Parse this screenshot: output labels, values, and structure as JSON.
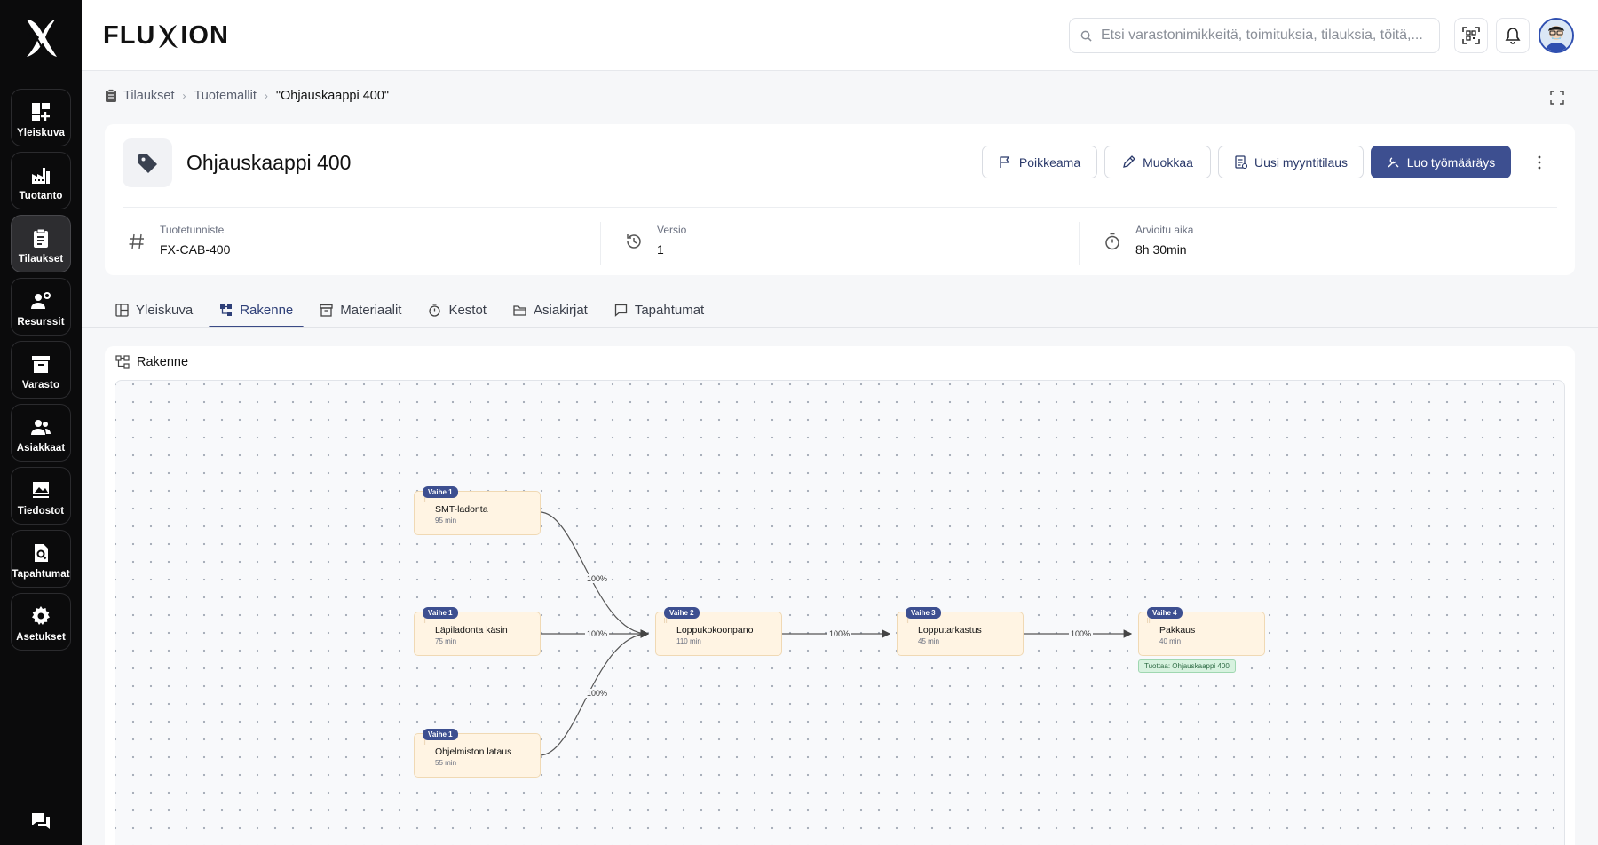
{
  "app": {
    "brand_left": "FLU",
    "brand_right": "ION"
  },
  "colors": {
    "sidebar_bg": "#0b0b0c",
    "accent": "#3d4f90",
    "node_bg": "#fff4e3",
    "output_tag_bg": "#d7f2df"
  },
  "sidebar": {
    "items": [
      {
        "label": "Yleiskuva",
        "icon": "dashboard-add-icon",
        "active": false
      },
      {
        "label": "Tuotanto",
        "icon": "factory-icon",
        "active": false
      },
      {
        "label": "Tilaukset",
        "icon": "clipboard-icon",
        "active": true
      },
      {
        "label": "Resurssit",
        "icon": "user-gear-icon",
        "active": false
      },
      {
        "label": "Varasto",
        "icon": "archive-icon",
        "active": false
      },
      {
        "label": "Asiakkaat",
        "icon": "people-icon",
        "active": false
      },
      {
        "label": "Tiedostot",
        "icon": "image-file-icon",
        "active": false
      },
      {
        "label": "Tapahtumat",
        "icon": "document-search-icon",
        "active": false
      },
      {
        "label": "Asetukset",
        "icon": "gear-icon",
        "active": false
      }
    ]
  },
  "header": {
    "search_placeholder": "Etsi varastonimikkeitä, toimituksia, tilauksia, töitä,..."
  },
  "breadcrumb": {
    "items": [
      "Tilaukset",
      "Tuotemallit"
    ],
    "current": "\"Ohjauskaappi 400\""
  },
  "product": {
    "title": "Ohjauskaappi 400",
    "actions": {
      "deviation": "Poikkeama",
      "edit": "Muokkaa",
      "new_sales_order": "Uusi myyntitilaus",
      "create_work_order": "Luo työmääräys"
    },
    "meta": [
      {
        "label": "Tuotetunniste",
        "value": "FX-CAB-400",
        "icon": "hash-icon"
      },
      {
        "label": "Versio",
        "value": "1",
        "icon": "history-icon"
      },
      {
        "label": "Arvioitu aika",
        "value": "8h 30min",
        "icon": "timer-icon"
      }
    ]
  },
  "tabs": [
    {
      "label": "Yleiskuva",
      "icon": "layout-icon",
      "active": false
    },
    {
      "label": "Rakenne",
      "icon": "tree-icon",
      "active": true
    },
    {
      "label": "Materiaalit",
      "icon": "box-icon",
      "active": false
    },
    {
      "label": "Kestot",
      "icon": "stopwatch-icon",
      "active": false
    },
    {
      "label": "Asiakirjat",
      "icon": "folder-icon",
      "active": false
    },
    {
      "label": "Tapahtumat",
      "icon": "message-icon",
      "active": false
    }
  ],
  "structure": {
    "title": "Rakenne",
    "nodes": [
      {
        "stage": "Vaihe 1",
        "name": "SMT-ladonta",
        "duration": "95 min"
      },
      {
        "stage": "Vaihe 1",
        "name": "Läpiladonta käsin",
        "duration": "75 min"
      },
      {
        "stage": "Vaihe 1",
        "name": "Ohjelmiston lataus",
        "duration": "55 min"
      },
      {
        "stage": "Vaihe 2",
        "name": "Loppukokoonpano",
        "duration": "110 min"
      },
      {
        "stage": "Vaihe 3",
        "name": "Lopputarkastus",
        "duration": "45 min"
      },
      {
        "stage": "Vaihe 4",
        "name": "Pakkaus",
        "duration": "40 min"
      }
    ],
    "edges": [
      {
        "from": "SMT-ladonta",
        "to": "Loppukokoonpano",
        "label": "100%"
      },
      {
        "from": "Läpiladonta käsin",
        "to": "Loppukokoonpano",
        "label": "100%"
      },
      {
        "from": "Ohjelmiston lataus",
        "to": "Loppukokoonpano",
        "label": "100%"
      },
      {
        "from": "Loppukokoonpano",
        "to": "Lopputarkastus",
        "label": "100%"
      },
      {
        "from": "Lopputarkastus",
        "to": "Pakkaus",
        "label": "100%"
      }
    ],
    "output_tag": "Tuottaa: Ohjauskaappi 400"
  }
}
